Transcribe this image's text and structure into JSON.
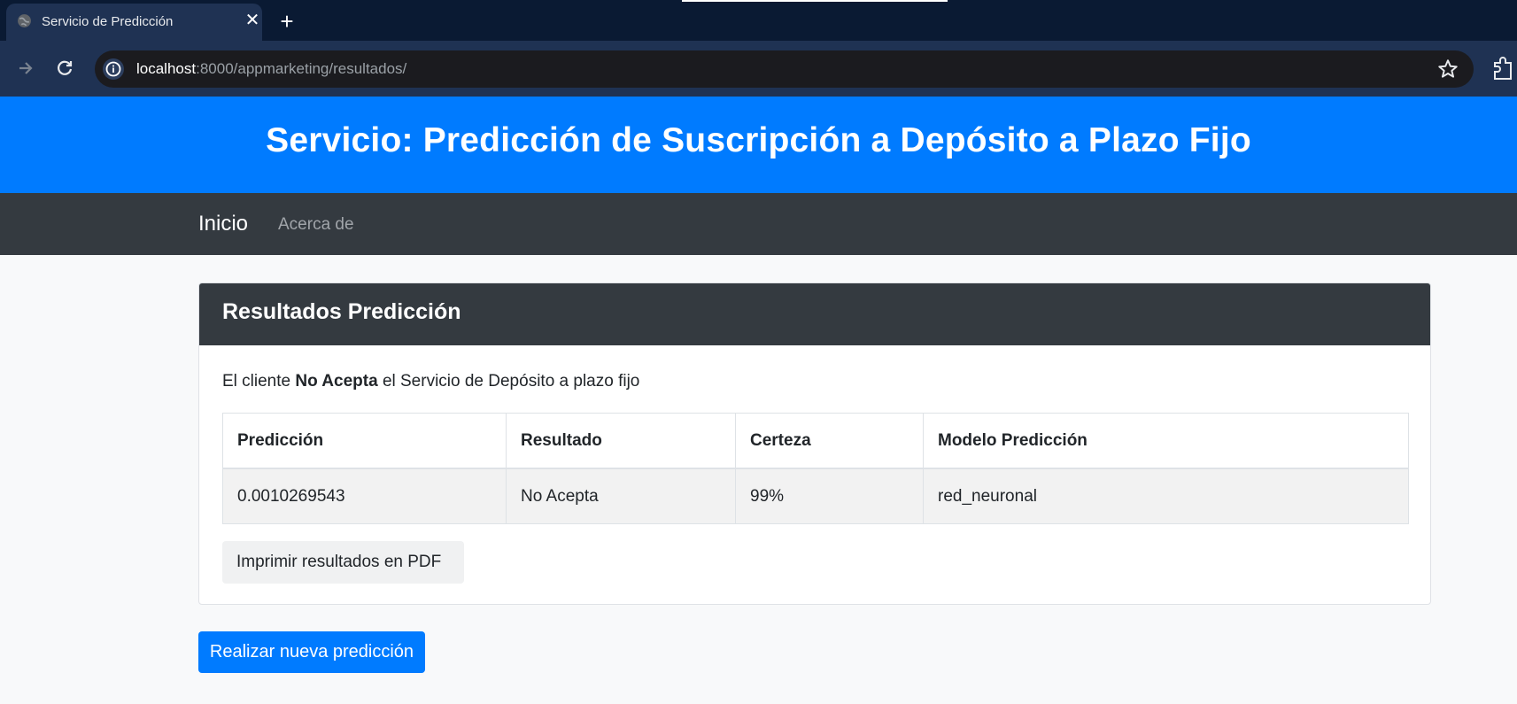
{
  "browser": {
    "tab_title": "Servicio de Predicción",
    "close_icon": "✕",
    "new_tab_icon": "+",
    "url_host": "localhost",
    "url_path": ":8000/appmarketing/resultados/"
  },
  "icons": {
    "back": "arrow-left-icon",
    "forward": "arrow-right-icon",
    "reload": "reload-icon",
    "info": "info-icon",
    "bookmark": "star-icon",
    "extensions": "puzzle-icon",
    "favicon": "globe-icon"
  },
  "header": {
    "title": "Servicio: Predicción de Suscripción a Depósito a Plazo Fijo"
  },
  "navbar": {
    "brand": "Inicio",
    "links": [
      "Acerca de"
    ]
  },
  "card": {
    "title": "Resultados Predicción",
    "summary_prefix": "El cliente",
    "summary_bold": "No Acepta",
    "summary_suffix": "el Servicio de Depósito a plazo fijo",
    "table": {
      "headers": [
        "Predicción",
        "Resultado",
        "Certeza",
        "Modelo Predicción"
      ],
      "rows": [
        [
          "0.0010269543",
          "No Acepta",
          "99%",
          "red_neuronal"
        ]
      ]
    },
    "pdf_button": "Imprimir resultados en PDF"
  },
  "new_prediction_button": "Realizar nueva predicción",
  "colors": {
    "primary": "#007bff",
    "dark": "#343a40",
    "tabbar": "#0a1a33",
    "toolbar": "#1f3253"
  }
}
